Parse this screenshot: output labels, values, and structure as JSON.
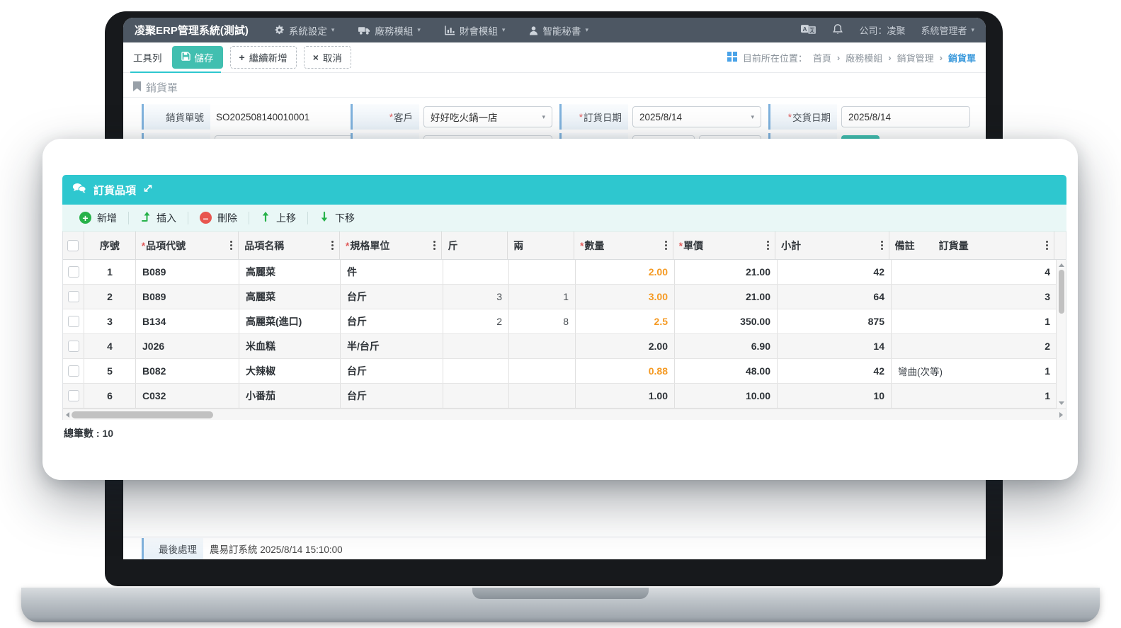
{
  "navbar": {
    "title": "凌聚ERP管理系統(測試)",
    "menus": [
      {
        "label": "系統設定",
        "icon": "gear-icon"
      },
      {
        "label": "廠務模組",
        "icon": "truck-icon"
      },
      {
        "label": "財會模組",
        "icon": "bar-chart-icon"
      },
      {
        "label": "智能秘書",
        "icon": "assistant-icon"
      }
    ],
    "company": "公司：凌聚",
    "user": "系統管理者"
  },
  "toolbar": {
    "label": "工具列",
    "save_label": "儲存",
    "continue_add_label": "繼續新增",
    "cancel_label": "取消"
  },
  "breadcrumb": {
    "prefix": "目前所在位置：",
    "items": [
      "首頁",
      "廠務模組",
      "銷貨管理",
      "銷貨單"
    ]
  },
  "form": {
    "section_title": "銷貨單",
    "fields": [
      {
        "label": "銷貨單號",
        "value": "SO202508140010001",
        "required": false
      },
      {
        "label": "客戶",
        "value": "好好吃火鍋一店",
        "required": true
      },
      {
        "label": "訂貨日期",
        "value": "2025/8/14",
        "required": true
      },
      {
        "label": "交貨日期",
        "value": "2025/8/14",
        "required": true
      }
    ]
  },
  "modal": {
    "title": "訂貨品項",
    "toolbar": [
      {
        "label": "新增",
        "icon": "plus-circle-icon"
      },
      {
        "label": "插入",
        "icon": "insert-arrow-icon"
      },
      {
        "label": "刪除",
        "icon": "minus-circle-icon"
      },
      {
        "label": "上移",
        "icon": "arrow-up-icon"
      },
      {
        "label": "下移",
        "icon": "arrow-down-icon"
      }
    ],
    "table": {
      "columns": [
        {
          "label": "序號"
        },
        {
          "label": "品項代號",
          "required": true,
          "menu": true
        },
        {
          "label": "品項名稱",
          "menu": true
        },
        {
          "label": "規格單位",
          "required": true,
          "menu": true
        },
        {
          "label": "斤"
        },
        {
          "label": "兩"
        },
        {
          "label": "數量",
          "required": true,
          "menu": true
        },
        {
          "label": "單價",
          "required": true,
          "menu": true
        },
        {
          "label": "小計",
          "menu": true
        },
        {
          "label": "備註"
        },
        {
          "label": "訂貨量",
          "menu": true
        }
      ],
      "rows": [
        {
          "seq": "1",
          "code": "B089",
          "name": "高麗菜",
          "unit": "件",
          "jin": "",
          "liang": "",
          "qty": "2.00",
          "price": "21.00",
          "subtotal": "42",
          "note": "",
          "order_qty": "4"
        },
        {
          "seq": "2",
          "code": "B089",
          "name": "高麗菜",
          "unit": "台斤",
          "jin": "3",
          "liang": "1",
          "qty": "3.00",
          "price": "21.00",
          "subtotal": "64",
          "note": "",
          "order_qty": "3"
        },
        {
          "seq": "3",
          "code": "B134",
          "name": "高麗菜(進口)",
          "unit": "台斤",
          "jin": "2",
          "liang": "8",
          "qty": "2.5",
          "price": "350.00",
          "subtotal": "875",
          "note": "",
          "order_qty": "1"
        },
        {
          "seq": "4",
          "code": "J026",
          "name": "米血糕",
          "unit": "半/台斤",
          "jin": "",
          "liang": "",
          "qty": "2.00",
          "price": "6.90",
          "subtotal": "14",
          "note": "",
          "order_qty": "2"
        },
        {
          "seq": "5",
          "code": "B082",
          "name": "大辣椒",
          "unit": "台斤",
          "jin": "",
          "liang": "",
          "qty": "0.88",
          "price": "48.00",
          "subtotal": "42",
          "note": "彎曲(次等)",
          "order_qty": "1"
        },
        {
          "seq": "6",
          "code": "C032",
          "name": "小番茄",
          "unit": "台斤",
          "jin": "",
          "liang": "",
          "qty": "1.00",
          "price": "10.00",
          "subtotal": "10",
          "note": "",
          "order_qty": "1"
        }
      ],
      "orange_qty_rows": [
        0,
        1,
        2,
        4
      ],
      "total_label": "總筆數 : 10"
    }
  },
  "footer": {
    "label": "最後處理",
    "value": "農易訂系統 2025/8/14 15:10:00"
  },
  "icons": {
    "caret_down": "▾",
    "breadcrumb_separator": "›",
    "plus": "+",
    "close": "×",
    "minus": "–"
  },
  "colors": {
    "navbar": "#4d5763",
    "accent_teal": "#2ec7cf",
    "button_teal": "#41bfb0",
    "toolbar_mint": "#e9f7f6",
    "orange": "#f59a23",
    "link_blue": "#3e9bdc",
    "accent_blue": "#7fb2dd"
  }
}
